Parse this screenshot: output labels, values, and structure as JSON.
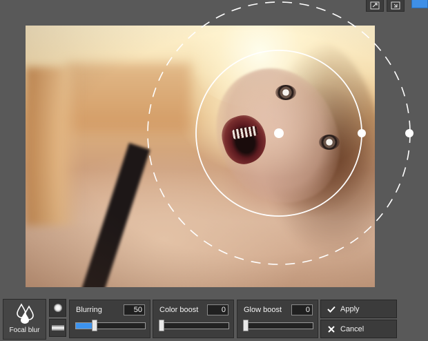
{
  "toolbar": {
    "icons": [
      "expand-icon",
      "fit-icon"
    ],
    "accent_color": "#3f8fe6"
  },
  "photo": {
    "focal_shape": "radial"
  },
  "tool": {
    "label": "Focal blur",
    "icon": "drops-icon"
  },
  "modes": [
    {
      "name": "radial",
      "icon": "circle-icon",
      "active": true
    },
    {
      "name": "linear",
      "icon": "bar-icon",
      "active": false
    }
  ],
  "sliders": [
    {
      "label": "Blurring",
      "value": "50",
      "percent": 25
    },
    {
      "label": "Color boost",
      "value": "0",
      "percent": 0
    },
    {
      "label": "Glow boost",
      "value": "0",
      "percent": 0
    }
  ],
  "actions": {
    "apply_label": "Apply",
    "cancel_label": "Cancel"
  },
  "colors": {
    "slider_fill": "#3d93ee",
    "panel_bg": "#3d3d3d"
  }
}
